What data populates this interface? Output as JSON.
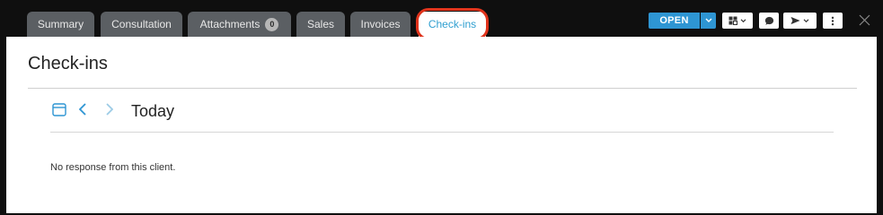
{
  "tabs": [
    {
      "label": "Summary",
      "active": false
    },
    {
      "label": "Consultation",
      "active": false
    },
    {
      "label": "Attachments",
      "active": false,
      "badge": "0"
    },
    {
      "label": "Sales",
      "active": false
    },
    {
      "label": "Invoices",
      "active": false
    },
    {
      "label": "Check-ins",
      "active": true
    }
  ],
  "toolbar": {
    "open_label": "OPEN",
    "icons": [
      "layout-grid-icon",
      "chat-bubble-icon",
      "send-icon",
      "more-vertical-icon",
      "close-icon"
    ]
  },
  "page": {
    "title": "Check-ins",
    "date_label": "Today",
    "empty_message": "No response from this client."
  },
  "colors": {
    "accent": "#2e95d3",
    "active_tab_text": "#2f9fd0",
    "highlight_ring": "#e0331b",
    "tab_bg": "#5b5f63",
    "window_bg": "#0f0f0f"
  }
}
